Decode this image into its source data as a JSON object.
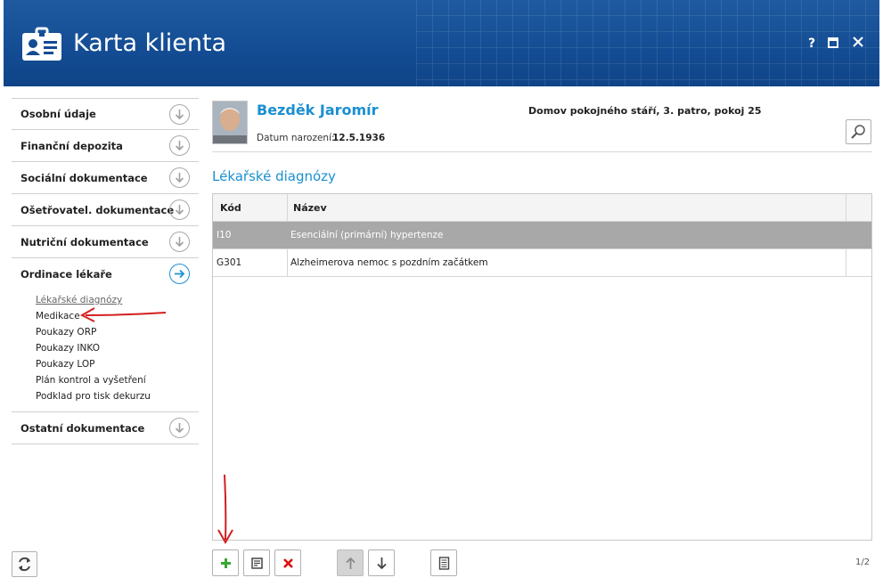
{
  "window": {
    "title": "Karta klienta",
    "controls": [
      "?",
      "□",
      "✕"
    ]
  },
  "sidebar": {
    "sections": [
      {
        "label": "Osobní údaje",
        "icon": "arrow-down-circle-icon"
      },
      {
        "label": "Finanční depozita",
        "icon": "arrow-down-circle-icon"
      },
      {
        "label": "Sociální dokumentace",
        "icon": "arrow-down-circle-icon"
      },
      {
        "label": "Ošetřovatel. dokumentace",
        "icon": "arrow-down-circle-icon"
      },
      {
        "label": "Nutriční dokumentace",
        "icon": "arrow-down-circle-icon"
      },
      {
        "label": "Ordinace lékaře",
        "icon": "arrow-right-circle-icon",
        "active": true
      },
      {
        "label": "Ostatní dokumentace",
        "icon": "arrow-down-circle-icon"
      }
    ],
    "ordinace_items": [
      "Lékařské diagnózy",
      "Medikace",
      "Poukazy ORP",
      "Poukazy INKO",
      "Poukazy LOP",
      "Plán kontrol a vyšetření",
      "Podklad pro tisk dekurzu"
    ],
    "current_item": "Lékařské diagnózy"
  },
  "patient": {
    "name": "Bezděk Jaromír",
    "dob_label": "Datum narození:",
    "dob": "12.5.1936",
    "location": "Domov pokojného stáří, 3. patro, pokoj 25"
  },
  "main": {
    "section_title": "Lékařské diagnózy",
    "table": {
      "columns": [
        "Kód",
        "Název"
      ],
      "rows": [
        {
          "code": "I10",
          "name": "Esenciální (primární) hypertenze",
          "selected": true
        },
        {
          "code": "G301",
          "name": "Alzheimerova nemoc s pozdním začátkem",
          "selected": false
        }
      ]
    },
    "toolbar": [
      "add-icon",
      "edit-icon",
      "delete-icon",
      "move-up-icon",
      "move-down-icon",
      "document-icon"
    ],
    "pager": "1/2"
  },
  "colors": {
    "header": "#134c93",
    "accent": "#1b8fd0",
    "selected_row": "#a8a8a8",
    "annotation": "#d21f1f",
    "add_green": "#3aa535",
    "delete_red": "#e01010"
  }
}
